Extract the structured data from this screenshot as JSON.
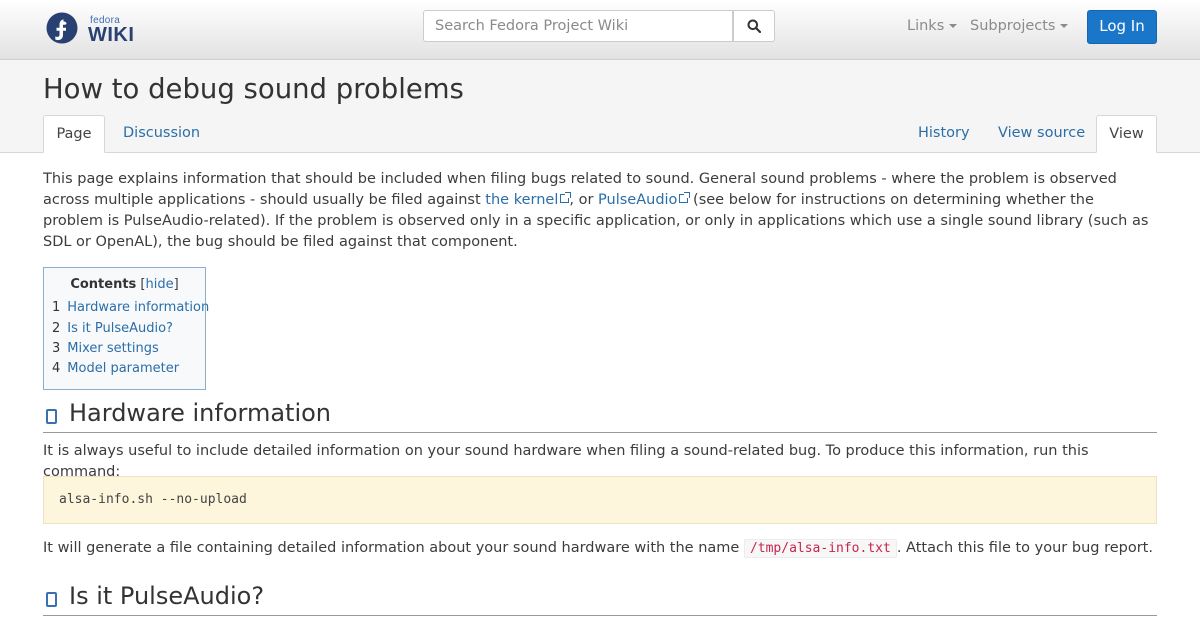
{
  "navbar": {
    "logo_small": "fedora",
    "logo_big": "WIKI",
    "search_placeholder": "Search Fedora Project Wiki",
    "links_label": "Links",
    "subprojects_label": "Subprojects",
    "login_label": "Log In",
    "icons": [
      "fedora-logo-icon",
      "search-icon",
      "caret-down-icon"
    ]
  },
  "page": {
    "title": "How to debug sound problems",
    "tabs_left": [
      "Page",
      "Discussion"
    ],
    "tabs_right": [
      "History",
      "View source",
      "View"
    ],
    "active_tabs": [
      "Page",
      "View"
    ]
  },
  "intro": {
    "text1": "This page explains information that should be included when filing bugs related to sound. General sound problems - where the problem is observed across multiple applications - should usually be filed against ",
    "link_kernel": "the kernel",
    "text2": ", or ",
    "link_pulseaudio": "PulseAudio",
    "text3": " (see below for instructions on determining whether the problem is PulseAudio-related). If the problem is observed only in a specific application, or only in applications which use a single sound library (such as SDL or OpenAL), the bug should be filed against that component."
  },
  "toc": {
    "title": "Contents",
    "hide_label": "hide",
    "items": [
      {
        "num": "1",
        "label": "Hardware information"
      },
      {
        "num": "2",
        "label": "Is it PulseAudio?"
      },
      {
        "num": "3",
        "label": "Mixer settings"
      },
      {
        "num": "4",
        "label": "Model parameter"
      }
    ]
  },
  "sections": {
    "hardware": {
      "heading": "Hardware information",
      "para": "It is always useful to include detailed information on your sound hardware when filing a sound-related bug. To produce this information, run this command:",
      "command": "alsa-info.sh --no-upload",
      "after_text1": "It will generate a file containing detailed information about your sound hardware with the name ",
      "file_path": "/tmp/alsa-info.txt",
      "after_text2": ". Attach this file to your bug report."
    },
    "pulseaudio": {
      "heading": "Is it PulseAudio?"
    }
  },
  "colors": {
    "accent_blue": "#1976c9",
    "link_blue": "#2b6ea8",
    "code_bg": "#fdf5dc",
    "inline_code": "#c7254e"
  }
}
